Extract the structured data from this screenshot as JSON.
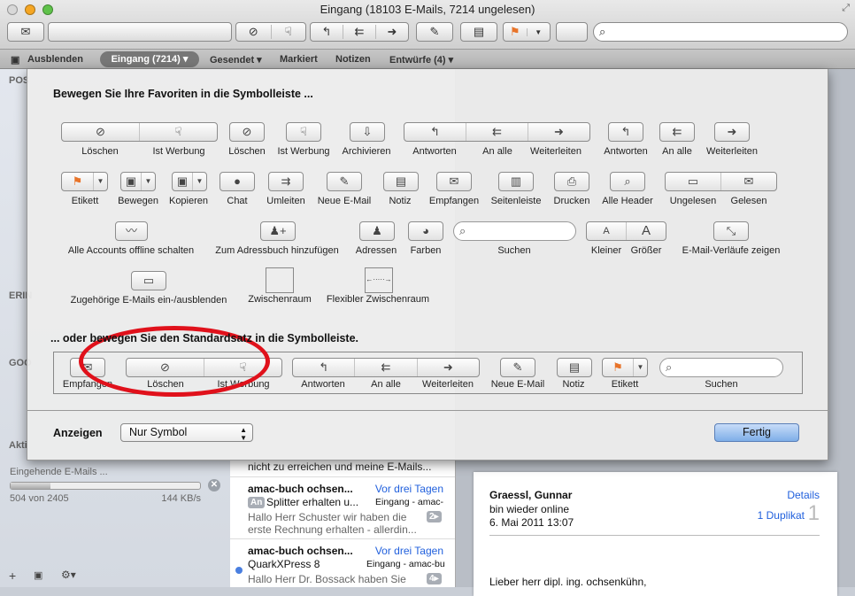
{
  "window": {
    "title": "Eingang (18103 E-Mails, 7214 ungelesen)"
  },
  "toolbar": {
    "icons": [
      "mail-icon",
      "delete-icon",
      "junk-icon",
      "reply-icon",
      "reply-all-icon",
      "forward-icon",
      "new-message-icon",
      "note-icon",
      "flag-icon",
      "search-icon"
    ]
  },
  "favorites_bar": {
    "hide": "Ausblenden",
    "inbox": "Eingang (7214) ▾",
    "sent": "Gesendet ▾",
    "flagged": "Markiert",
    "notes": "Notizen",
    "drafts": "Entwürfe (4) ▾"
  },
  "sidebar": {
    "fragments": [
      "POS",
      "ERIN",
      "GOO",
      "Akti"
    ],
    "activity_title": "Eingehende E-Mails ...",
    "progress_text": "504 von 2405",
    "progress_fraction": 0.21,
    "speed": "144 KB/s"
  },
  "message_list": {
    "partial_preview": "nicht zu erreichen und meine E-Mails...",
    "items": [
      {
        "sender": "amac-buch ochsen...",
        "date": "Vor drei Tagen",
        "badge": "An",
        "subject": "Splitter erhalten u...",
        "mailbox": "Eingang - amac-",
        "preview1": "Hallo Herr Schuster wir haben die",
        "preview2": "erste Rechnung erhalten - allerdin...",
        "count": "2▸"
      },
      {
        "sender": "amac-buch ochsen...",
        "date": "Vor drei Tagen",
        "subject": "QuarkXPress 8",
        "mailbox": "Eingang - amac-bu",
        "preview1": "Hallo Herr Dr. Bossack haben Sie",
        "count": "4▸",
        "unread": true
      }
    ]
  },
  "message": {
    "sender": "Graessl, Gunnar",
    "subject": "bin wieder online",
    "date": "6. Mai 2011 13:07",
    "details": "Details",
    "duplicate": "1 Duplikat",
    "duplicate_count": "1",
    "body": "Lieber herr dipl. ing. ochsenkühn,"
  },
  "sheet": {
    "heading_favorites": "Bewegen Sie Ihre Favoriten in die Symbolleiste ...",
    "heading_default": "... oder bewegen Sie den Standardsatz in die Symbolleiste.",
    "items": [
      {
        "label": "Löschen",
        "icon": "delete-icon"
      },
      {
        "label": "Ist Werbung",
        "icon": "junk-icon"
      },
      {
        "label": "Löschen",
        "icon": "delete-icon"
      },
      {
        "label": "Ist Werbung",
        "icon": "junk-icon"
      },
      {
        "label": "Archivieren",
        "icon": "archive-icon"
      },
      {
        "label": "Antworten",
        "icon": "reply-icon"
      },
      {
        "label": "An alle",
        "icon": "reply-all-icon"
      },
      {
        "label": "Weiterleiten",
        "icon": "forward-icon"
      },
      {
        "label": "Antworten",
        "icon": "reply-icon"
      },
      {
        "label": "An alle",
        "icon": "reply-all-icon"
      },
      {
        "label": "Weiterleiten",
        "icon": "forward-icon"
      },
      {
        "label": "Etikett",
        "icon": "flag-icon"
      },
      {
        "label": "Bewegen",
        "icon": "move-folder-icon"
      },
      {
        "label": "Kopieren",
        "icon": "copy-folder-icon"
      },
      {
        "label": "Chat",
        "icon": "chat-icon"
      },
      {
        "label": "Umleiten",
        "icon": "redirect-icon"
      },
      {
        "label": "Neue E-Mail",
        "icon": "new-message-icon"
      },
      {
        "label": "Notiz",
        "icon": "note-icon"
      },
      {
        "label": "Empfangen",
        "icon": "mail-icon"
      },
      {
        "label": "Seitenleiste",
        "icon": "sidebar-icon"
      },
      {
        "label": "Drucken",
        "icon": "print-icon"
      },
      {
        "label": "Alle Header",
        "icon": "headers-icon"
      },
      {
        "label": "Ungelesen",
        "icon": "unread-icon"
      },
      {
        "label": "Gelesen",
        "icon": "read-icon"
      },
      {
        "label": "Alle Accounts offline schalten",
        "icon": "offline-icon"
      },
      {
        "label": "Zum Adressbuch hinzufügen",
        "icon": "add-contact-icon"
      },
      {
        "label": "Adressen",
        "icon": "contact-icon"
      },
      {
        "label": "Farben",
        "icon": "palette-icon"
      },
      {
        "label": "Suchen",
        "icon": "search-icon"
      },
      {
        "label": "Kleiner",
        "icon": "smaller-font-icon"
      },
      {
        "label": "Größer",
        "icon": "bigger-font-icon"
      },
      {
        "label": "E-Mail-Verläufe zeigen",
        "icon": "threads-icon"
      },
      {
        "label": "Zugehörige E-Mails ein-/ausblenden",
        "icon": "related-mails-icon"
      },
      {
        "label": "Zwischenraum",
        "icon": "space"
      },
      {
        "label": "Flexibler Zwischenraum",
        "icon": "flexible-space"
      }
    ],
    "default_set": [
      {
        "label": "Empfangen",
        "icon": "mail-icon"
      },
      {
        "label": "Löschen",
        "icon": "delete-icon"
      },
      {
        "label": "Ist Werbung",
        "icon": "junk-icon"
      },
      {
        "label": "Antworten",
        "icon": "reply-icon"
      },
      {
        "label": "An alle",
        "icon": "reply-all-icon"
      },
      {
        "label": "Weiterleiten",
        "icon": "forward-icon"
      },
      {
        "label": "Neue E-Mail",
        "icon": "new-message-icon"
      },
      {
        "label": "Notiz",
        "icon": "note-icon"
      },
      {
        "label": "Etikett",
        "icon": "flag-icon"
      },
      {
        "label": "Suchen",
        "icon": "search-icon"
      }
    ],
    "show_label": "Anzeigen",
    "show_value": "Nur Symbol",
    "done_label": "Fertig",
    "highlight_color": "#e0111b"
  }
}
